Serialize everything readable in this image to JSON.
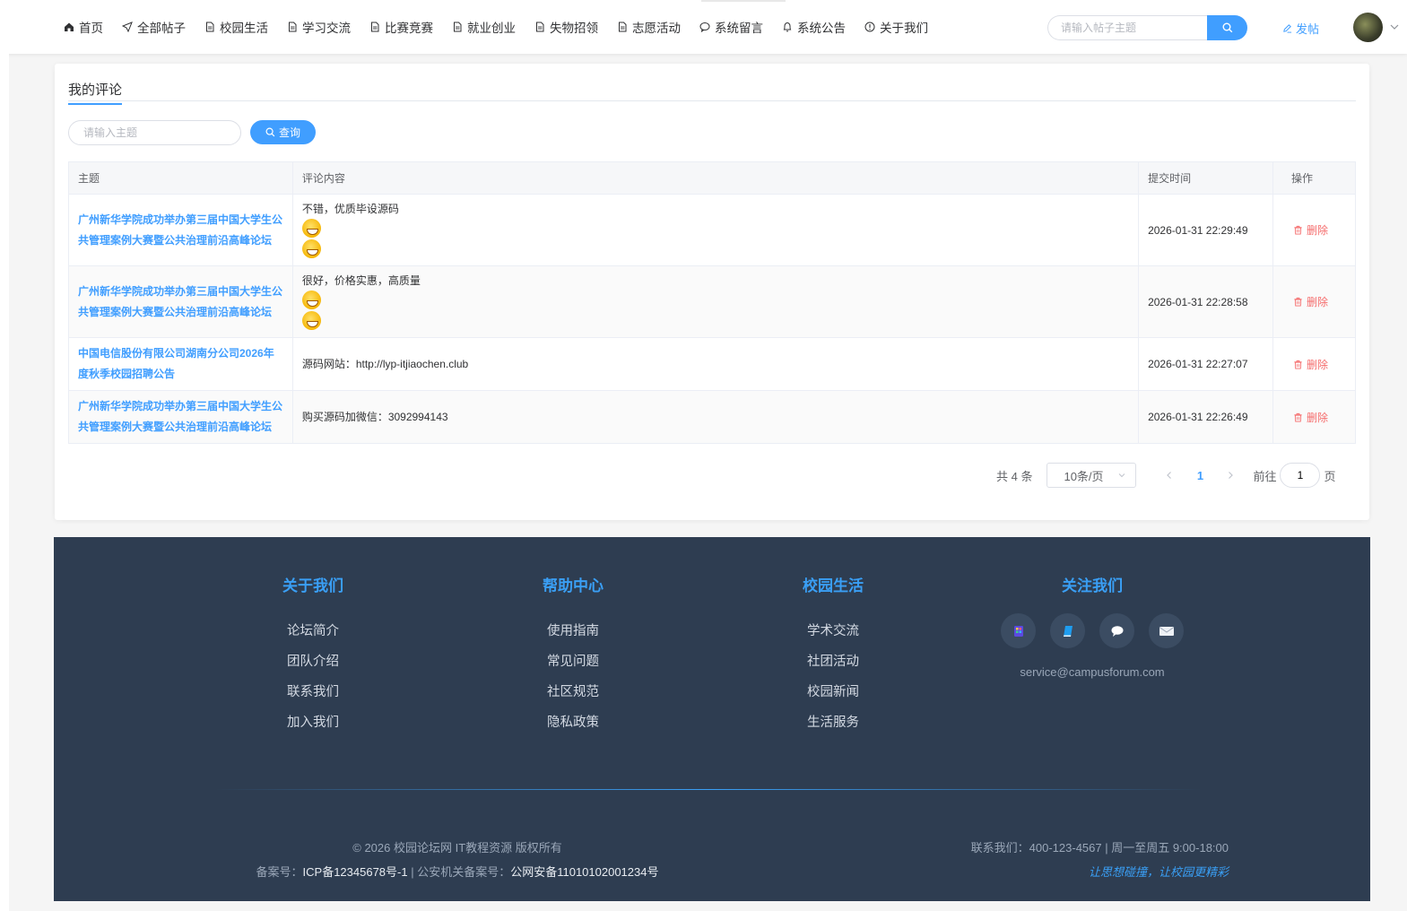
{
  "nav": {
    "items": [
      {
        "label": "首页",
        "icon": "home-icon"
      },
      {
        "label": "全部帖子",
        "icon": "send-icon"
      },
      {
        "label": "校园生活",
        "icon": "document-icon"
      },
      {
        "label": "学习交流",
        "icon": "document-icon"
      },
      {
        "label": "比赛竞赛",
        "icon": "document-icon"
      },
      {
        "label": "就业创业",
        "icon": "document-icon"
      },
      {
        "label": "失物招领",
        "icon": "document-icon"
      },
      {
        "label": "志愿活动",
        "icon": "document-icon"
      },
      {
        "label": "系统留言",
        "icon": "chat-icon"
      },
      {
        "label": "系统公告",
        "icon": "bell-icon"
      },
      {
        "label": "关于我们",
        "icon": "info-icon"
      }
    ],
    "search_placeholder": "请输入帖子主题",
    "post_label": "发帖"
  },
  "page": {
    "title": "我的评论",
    "query_placeholder": "请输入主题",
    "query_button": "查询"
  },
  "table": {
    "headers": [
      "主题",
      "评论内容",
      "提交时间",
      "操作"
    ],
    "rows": [
      {
        "title": "广州新华学院成功举办第三届中国大学生公共管理案例大赛暨公共治理前沿高峰论坛",
        "content": "不错，优质毕设源码",
        "emojis": 2,
        "time": "2026-01-31 22:29:49",
        "action": "删除"
      },
      {
        "title": "广州新华学院成功举办第三届中国大学生公共管理案例大赛暨公共治理前沿高峰论坛",
        "content": "很好，价格实惠，高质量",
        "emojis": 2,
        "time": "2026-01-31 22:28:58",
        "action": "删除"
      },
      {
        "title": "中国电信股份有限公司湖南分公司2026年度秋季校园招聘公告",
        "content": "源码网站：http://lyp-itjiaochen.club",
        "emojis": 0,
        "time": "2026-01-31 22:27:07",
        "action": "删除"
      },
      {
        "title": "广州新华学院成功举办第三届中国大学生公共管理案例大赛暨公共治理前沿高峰论坛",
        "content": "购买源码加微信：3092994143",
        "emojis": 0,
        "time": "2026-01-31 22:26:49",
        "action": "删除"
      }
    ]
  },
  "pager": {
    "total": "共 4 条",
    "size": "10条/页",
    "current": "1",
    "goto_prefix": "前往",
    "goto_value": "1",
    "goto_suffix": "页"
  },
  "footer": {
    "cols": [
      {
        "title": "关于我们",
        "links": [
          "论坛简介",
          "团队介绍",
          "联系我们",
          "加入我们"
        ]
      },
      {
        "title": "帮助中心",
        "links": [
          "使用指南",
          "常见问题",
          "社区规范",
          "隐私政策"
        ]
      },
      {
        "title": "校园生活",
        "links": [
          "学术交流",
          "社团活动",
          "校园新闻",
          "生活服务"
        ]
      }
    ],
    "follow_title": "关注我们",
    "email": "service@campusforum.com",
    "copyright": "© 2026 校园论坛网 IT教程资源 版权所有",
    "icp_label": "备案号：",
    "icp": "ICP备12345678号-1",
    "police_label": " | 公安机关备案号：",
    "police": "公网安备11010102001234号",
    "contact": "联系我们：400-123-4567 | 周一至周五 9:00-18:00",
    "slogan": "让思想碰撞，让校园更精彩"
  },
  "colors": {
    "accent": "#409eff",
    "danger": "#f56c6c",
    "footer_bg": "#2e3d51"
  }
}
